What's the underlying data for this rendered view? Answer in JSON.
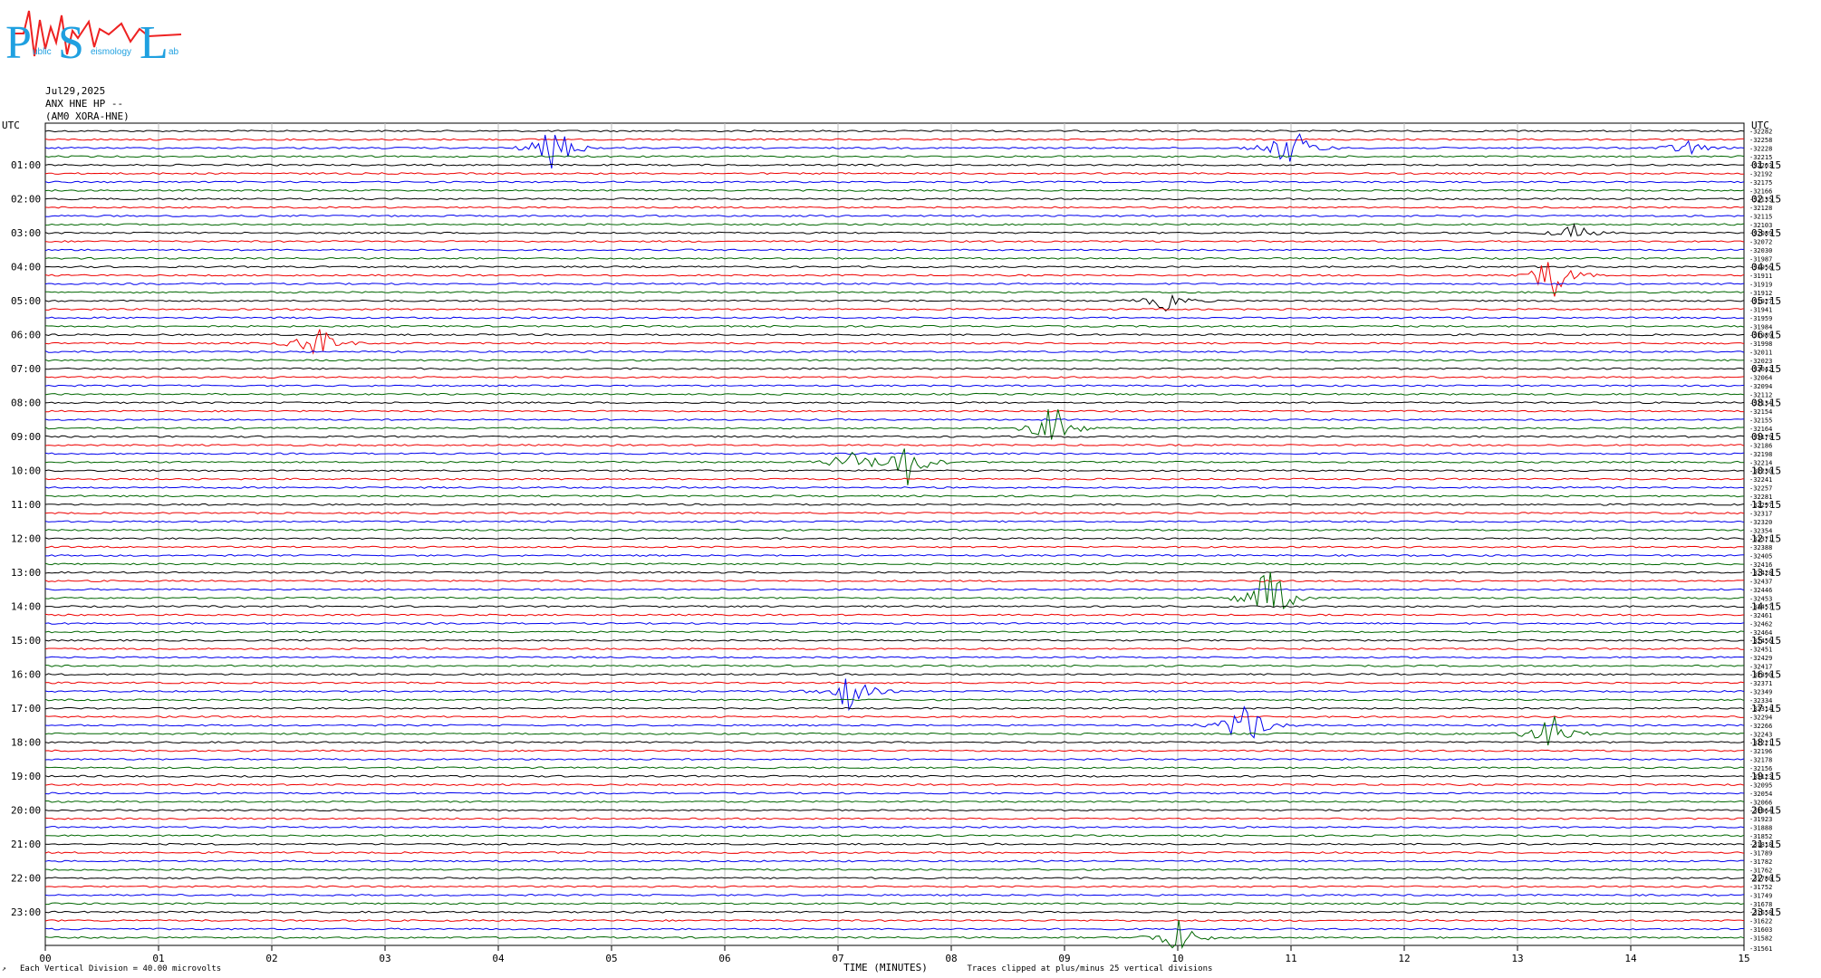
{
  "logo": {
    "letters": [
      "P",
      "S",
      "L"
    ],
    "tagline_parts": [
      "ublic",
      "eismology",
      "ab"
    ]
  },
  "header": {
    "date": "Jul29,2025",
    "channel": "ANX HNE HP --",
    "station": "(AM0 XORA-HNE)"
  },
  "footer": {
    "scale_note": "Each Vertical Division =   40.00 microvolts",
    "corner_mark": "↗",
    "clip_note": "Traces clipped at plus/minus 25 vertical divisions"
  },
  "colors": {
    "trace_cycle": [
      "#000000",
      "#ee0000",
      "#0000ee",
      "#006600"
    ],
    "grid": "#bbbbbb"
  },
  "chart_data": {
    "type": "helicorder",
    "xlabel": "TIME (MINUTES)",
    "x_ticks": [
      "00",
      "01",
      "02",
      "03",
      "04",
      "05",
      "06",
      "07",
      "08",
      "09",
      "10",
      "11",
      "12",
      "13",
      "14",
      "15"
    ],
    "xlim": [
      0,
      15
    ],
    "left_axis_title": "UTC",
    "right_axis_title": "UTC",
    "left_hour_labels": [
      "01:00",
      "02:00",
      "03:00",
      "04:00",
      "05:00",
      "06:00",
      "07:00",
      "08:00",
      "09:00",
      "10:00",
      "11:00",
      "12:00",
      "13:00",
      "14:00",
      "15:00",
      "16:00",
      "17:00",
      "18:00",
      "19:00",
      "20:00",
      "21:00",
      "22:00",
      "23:00"
    ],
    "right_hour_labels": [
      "01:15",
      "02:15",
      "03:15",
      "04:15",
      "05:15",
      "06:15",
      "07:15",
      "08:15",
      "09:15",
      "10:15",
      "11:15",
      "12:15",
      "13:15",
      "14:15",
      "15:15",
      "16:15",
      "17:15",
      "18:15",
      "19:15",
      "20:15",
      "21:15",
      "22:15",
      "23:15"
    ],
    "trace_count": 96,
    "trace_minutes": 15,
    "trace_offsets": [
      -32282,
      -32258,
      -32228,
      -32215,
      -32203,
      -32192,
      -32175,
      -32166,
      -32135,
      -32128,
      -32115,
      -32103,
      -32089,
      -32072,
      -32030,
      -31987,
      -31956,
      -31911,
      -31919,
      -31912,
      -31927,
      -31941,
      -31959,
      -31984,
      -31989,
      -31998,
      -32011,
      -32023,
      -32042,
      -32064,
      -32094,
      -32112,
      -32134,
      -32154,
      -32155,
      -32164,
      -32179,
      -32186,
      -32198,
      -32214,
      -32230,
      -32241,
      -32257,
      -32281,
      -32297,
      -32317,
      -32320,
      -32354,
      -32371,
      -32388,
      -32405,
      -32416,
      -32428,
      -32437,
      -32446,
      -32453,
      -32457,
      -32461,
      -32462,
      -32464,
      -32456,
      -32451,
      -32429,
      -32417,
      -32390,
      -32371,
      -32349,
      -32334,
      -32314,
      -32294,
      -32266,
      -32243,
      -32221,
      -32196,
      -32178,
      -32156,
      -32123,
      -32095,
      -32054,
      -32066,
      -31964,
      -31923,
      -31888,
      -31852,
      -31818,
      -31789,
      -31782,
      -31762,
      -31780,
      -31752,
      -31749,
      -31678,
      -31658,
      -31622,
      -31603,
      -31582
    ],
    "final_offset_label": "-31561",
    "events": [
      {
        "trace": 2,
        "minute": 4.5,
        "amplitude": 30
      },
      {
        "trace": 2,
        "minute": 11.0,
        "amplitude": 30
      },
      {
        "trace": 2,
        "minute": 14.5,
        "amplitude": 10
      },
      {
        "trace": 12,
        "minute": 13.5,
        "amplitude": 10
      },
      {
        "trace": 17,
        "minute": 13.3,
        "amplitude": 30
      },
      {
        "trace": 20,
        "minute": 9.9,
        "amplitude": 12
      },
      {
        "trace": 25,
        "minute": 2.4,
        "amplitude": 22
      },
      {
        "trace": 39,
        "minute": 7.6,
        "amplitude": 30
      },
      {
        "trace": 39,
        "minute": 7.1,
        "amplitude": 14
      },
      {
        "trace": 35,
        "minute": 8.9,
        "amplitude": 30
      },
      {
        "trace": 55,
        "minute": 10.8,
        "amplitude": 45
      },
      {
        "trace": 66,
        "minute": 7.1,
        "amplitude": 24
      },
      {
        "trace": 70,
        "minute": 10.6,
        "amplitude": 30
      },
      {
        "trace": 71,
        "minute": 13.3,
        "amplitude": 24
      },
      {
        "trace": 95,
        "minute": 10.0,
        "amplitude": 22
      }
    ]
  }
}
